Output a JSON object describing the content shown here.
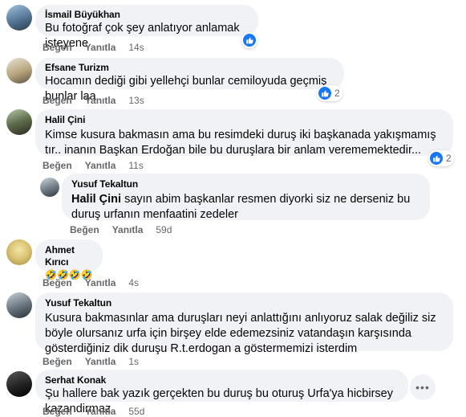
{
  "colors": {
    "bubble": "#f0f2f5",
    "like_blue": "#1877f2",
    "meta_gray": "#65676b"
  },
  "comments": [
    {
      "author": "İsmail Büyükhan",
      "text": "Bu fotoğraf çok şey anlatıyor anlamak isteyene",
      "like": "Beğen",
      "reply": "Yanıtla",
      "time": "14s",
      "reaction_count": ""
    },
    {
      "author": "Efsane Turizm",
      "text": "Hocamın dediği gibi yellehçi bunlar cemiloyuda geçmiş bunlar laa",
      "like": "Beğen",
      "reply": "Yanıtla",
      "time": "13s",
      "reaction_count": "2"
    },
    {
      "author": "Halil Çini",
      "text": "Kimse kusura bakmasın ama bu resimdeki duruş iki başkanada yakışmamış tır.. inanın Başkan Erdoğan bile bu duruşlara bir anlam verememektedir...",
      "like": "Beğen",
      "reply": "Yanıtla",
      "time": "11s",
      "reaction_count": "2"
    },
    {
      "author": "Yusuf Tekaltun",
      "mention": "Halil Çini",
      "text": " sayın abim başkanlar resmen diyorki siz ne derseniz bu duruş urfanın menfaatini zedeler",
      "like": "Beğen",
      "reply": "Yanıtla",
      "time": "59d"
    },
    {
      "author": "Ahmet Kırıcı",
      "text": "🤣🤣🤣🤣",
      "like": "Beğen",
      "reply": "Yanıtla",
      "time": "4s"
    },
    {
      "author": "Yusuf Tekaltun",
      "text": "Kusura bakmasınlar ama duruşları neyi anlattığını anlıyoruz salak değiliz siz böyle olursanız urfa için birşey elde edemezsiniz vatandaşın karşısında gösterdiğiniz dik duruşu R.t.erdogan a göstermemizi isterdim",
      "like": "Beğen",
      "reply": "Yanıtla",
      "time": "1s"
    },
    {
      "author": "Serhat Konak",
      "text": "Şu hallere bak yazık gerçekten bu duruş bu oturuş Urfa'ya hicbirsey kazandirmaz",
      "like": "Beğen",
      "reply": "Yanıtla",
      "time": "55d",
      "more": "•••"
    }
  ]
}
